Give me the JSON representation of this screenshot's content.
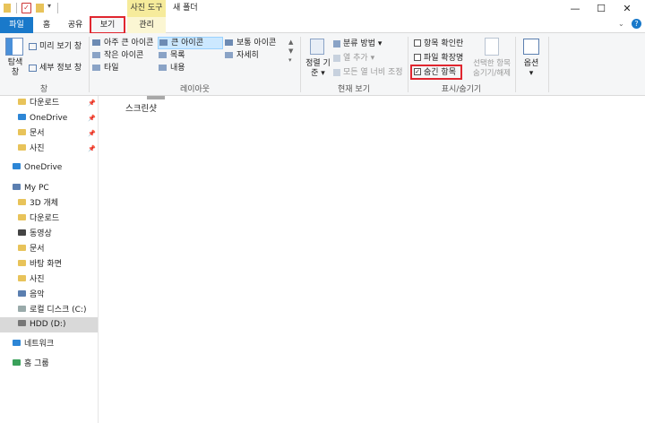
{
  "window": {
    "context_tab": "사진 도구",
    "title": "새 폴더",
    "min": "—",
    "max": "☐",
    "close": "✕"
  },
  "tabs": [
    {
      "label": "파일"
    },
    {
      "label": "홈"
    },
    {
      "label": "공유"
    },
    {
      "label": "보기"
    },
    {
      "label": "관리"
    }
  ],
  "ribbon": {
    "pane": {
      "nav_label": "탐색\n창",
      "preview": "미리 보기 창",
      "details": "세부 정보 창",
      "group": "창"
    },
    "layout": {
      "items": [
        "아주 큰 아이콘",
        "큰 아이콘",
        "보통 아이콘",
        "작은 아이콘",
        "목록",
        "자세히",
        "타일",
        "내용"
      ],
      "group": "레이아웃"
    },
    "current_view": {
      "sort_label": "정렬 기준",
      "group_by": "분류 방법",
      "add_col": "열 추가",
      "fit_cols": "모든 열 너비 조정",
      "group": "현재 보기"
    },
    "show_hide": {
      "checkboxes": "항목 확인란",
      "extensions": "파일 확장명",
      "hidden": "숨긴 항목",
      "hide_selected": "선택한 항목\n숨기기/해제",
      "group": "표시/숨기기"
    },
    "options": "옵션"
  },
  "sidebar": {
    "quick": [
      "다운로드",
      "OneDrive",
      "문서",
      "사진"
    ],
    "onedrive": "OneDrive",
    "mypc": "My PC",
    "pc_items": [
      "3D 개체",
      "다운로드",
      "동영상",
      "문서",
      "바탕 화면",
      "사진",
      "음악",
      "로컬 디스크 (C:)",
      "HDD (D:)"
    ],
    "network": "네트워크",
    "homegroup": "홈 그룹"
  },
  "content": {
    "file_label": "스크린샷"
  },
  "colors": {
    "file_tab": "#1979ca",
    "selected_bg": "#cce8ff",
    "highlight": "#e0262f"
  }
}
